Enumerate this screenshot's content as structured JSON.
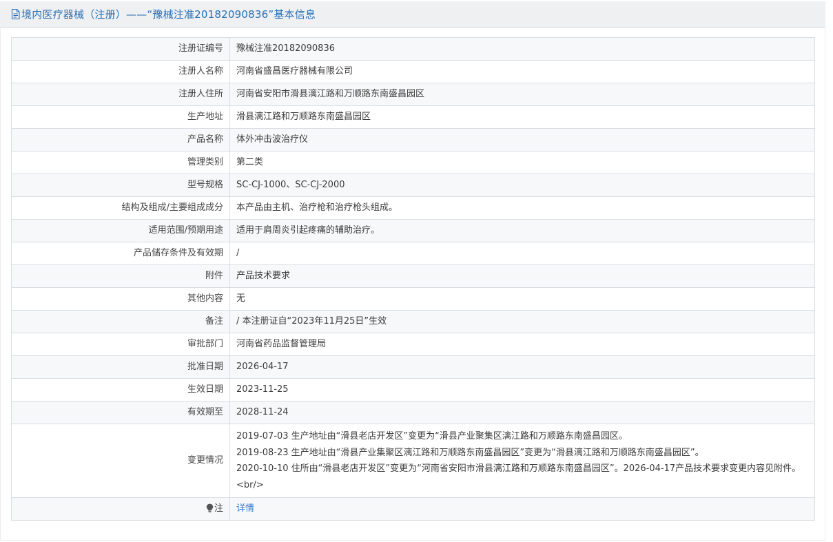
{
  "header": {
    "title": "境内医疗器械（注册）——“豫械注准20182090836”基本信息"
  },
  "rows": [
    {
      "label": "注册证编号",
      "value": "豫械注准20182090836"
    },
    {
      "label": "注册人名称",
      "value": "河南省盛昌医疗器械有限公司"
    },
    {
      "label": "注册人住所",
      "value": "河南省安阳市滑县漓江路和万顺路东南盛昌园区"
    },
    {
      "label": "生产地址",
      "value": "滑县漓江路和万顺路东南盛昌园区"
    },
    {
      "label": "产品名称",
      "value": "体外冲击波治疗仪"
    },
    {
      "label": "管理类别",
      "value": "第二类"
    },
    {
      "label": "型号规格",
      "value": "SC-CJ-1000、SC-CJ-2000"
    },
    {
      "label": "结构及组成/主要组成成分",
      "value": "本产品由主机、治疗枪和治疗枪头组成。"
    },
    {
      "label": "适用范围/预期用途",
      "value": "适用于肩周炎引起疼痛的辅助治疗。"
    },
    {
      "label": "产品储存条件及有效期",
      "value": "/"
    },
    {
      "label": "附件",
      "value": "产品技术要求"
    },
    {
      "label": "其他内容",
      "value": "无"
    },
    {
      "label": "备注",
      "value": "/ 本注册证自“2023年11月25日”生效"
    },
    {
      "label": "审批部门",
      "value": "河南省药品监督管理局"
    },
    {
      "label": "批准日期",
      "value": "2026-04-17"
    },
    {
      "label": "生效日期",
      "value": "2023-11-25"
    },
    {
      "label": "有效期至",
      "value": "2028-11-24"
    }
  ],
  "changes": {
    "label": "变更情况",
    "lines": [
      "2019-07-03 生产地址由“滑县老店开发区”变更为“滑县产业聚集区漓江路和万顺路东南盛昌园区。",
      "2019-08-23 生产地址由“滑县产业集聚区漓江路和万顺路东南盛昌园区”变更为“滑县漓江路和万顺路东南盛昌园区”。",
      "2020-10-10 住所由“滑县老店开发区”变更为“河南省安阳市滑县漓江路和万顺路东南盛昌园区”。2026-04-17产品技术要求变更内容见附件。<br/>"
    ]
  },
  "note": {
    "label": "注",
    "icon": "lightbulb-icon",
    "link_text": "详情"
  },
  "colors": {
    "title_blue": "#2a6fb5",
    "link_blue": "#2a7ad2",
    "row_stripe": "#f7f8f9",
    "border": "#d9dde2"
  }
}
